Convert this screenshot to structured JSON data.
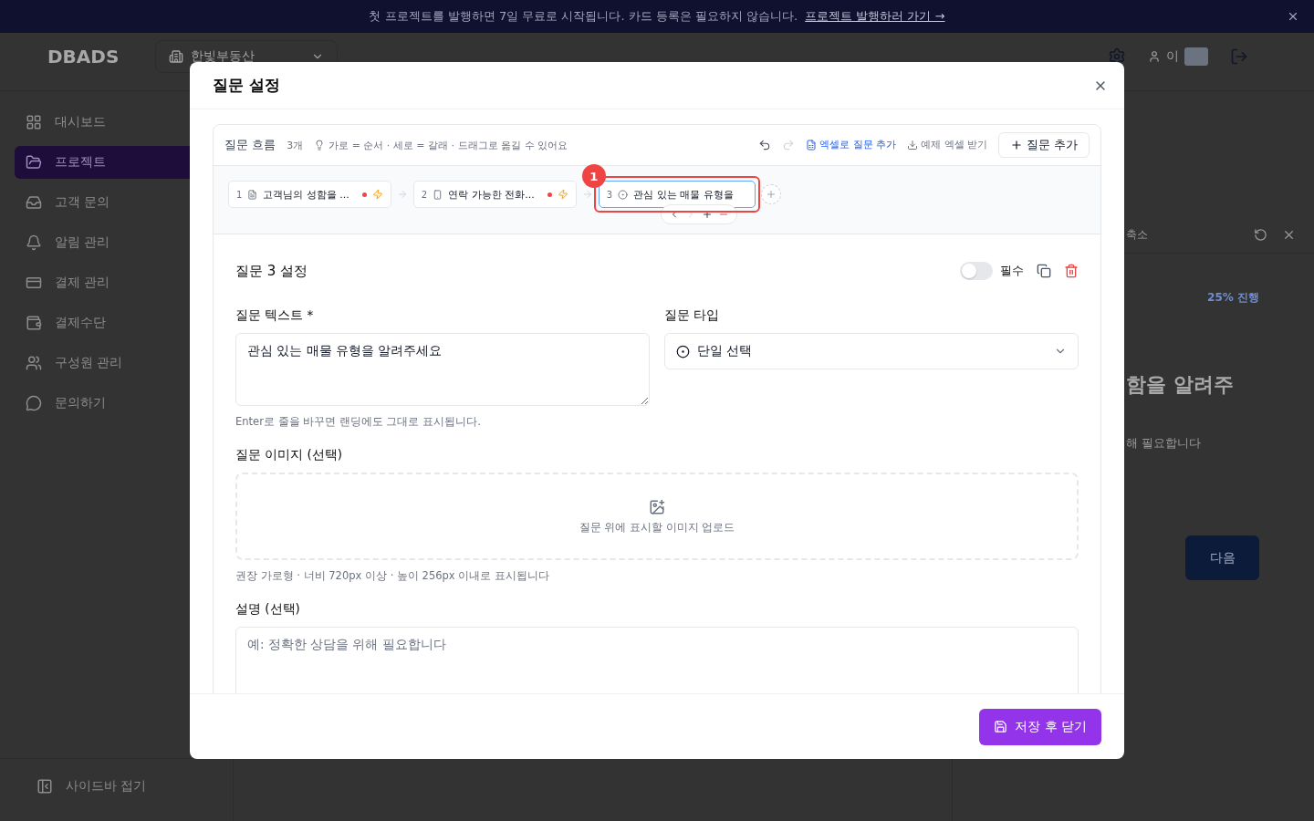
{
  "banner": {
    "text": "첫 프로젝트를 발행하면 7일 무료로 시작됩니다. 카드 등록은 필요하지 않습니다.",
    "link": "프로젝트 발행하러 가기 →"
  },
  "topbar": {
    "logo": "DBADS",
    "workspace": "한빛부동산",
    "user": "이"
  },
  "sidebar": {
    "items": [
      {
        "label": "대시보드",
        "selected": false
      },
      {
        "label": "프로젝트",
        "selected": true
      },
      {
        "label": "고객 문의",
        "selected": false
      },
      {
        "label": "알림 관리",
        "selected": false
      },
      {
        "label": "결제 관리",
        "selected": false
      },
      {
        "label": "결제수단",
        "selected": false
      },
      {
        "label": "구성원 관리",
        "selected": false
      },
      {
        "label": "문의하기",
        "selected": false
      }
    ],
    "collapse": "사이드바 접기"
  },
  "preview": {
    "shrink": "축소",
    "progress": "25% 진행",
    "question": "함을 알려주",
    "description": "해 필요합니다",
    "next": "다음"
  },
  "modal": {
    "title": "질문 설정",
    "flow": {
      "title": "질문 흐름",
      "count": "3개",
      "hint": "가로 = 순서 · 세로 = 갈래 · 드래그로 옮길 수 있어요",
      "excel_add": "엑셀로 질문 추가",
      "excel_sample": "예제 엑셀 받기",
      "add": "질문 추가",
      "redo_disabled": true,
      "nodes": [
        {
          "number": "1",
          "label": "고객님의 성함을 ...",
          "selected": false,
          "required": true,
          "logic": true
        },
        {
          "number": "2",
          "label": "연락 가능한 전화...",
          "selected": false,
          "required": true,
          "logic": true
        },
        {
          "number": "3",
          "label": "관심 있는 매물 유형을",
          "selected": true,
          "required": false,
          "logic": false,
          "callout": "1",
          "toolbar": [
            {
              "kind": "prev",
              "disabled": false
            },
            {
              "kind": "next",
              "disabled": true
            },
            {
              "kind": "add",
              "disabled": false
            },
            {
              "kind": "remove",
              "disabled": false
            }
          ]
        }
      ]
    },
    "settings": {
      "title": "질문 3 설정",
      "required_label": "필수",
      "required": false,
      "text_label": "질문 텍스트 *",
      "text_value": "관심 있는 매물 유형을 알려주세요",
      "text_help": "Enter로 줄을 바꾸면 랜딩에도 그대로 표시됩니다.",
      "type_label": "질문 타입",
      "type_value": "단일 선택",
      "image_label": "질문 이미지 (선택)",
      "image_upload": "질문 위에 표시할 이미지 업로드",
      "image_help": "권장 가로형 · 너비 720px 이상 · 높이 256px 이내로 표시됩니다",
      "desc_label": "설명 (선택)",
      "desc_placeholder": "예: 정확한 상담을 위해 필요합니다"
    },
    "save": "저장 후 닫기"
  }
}
